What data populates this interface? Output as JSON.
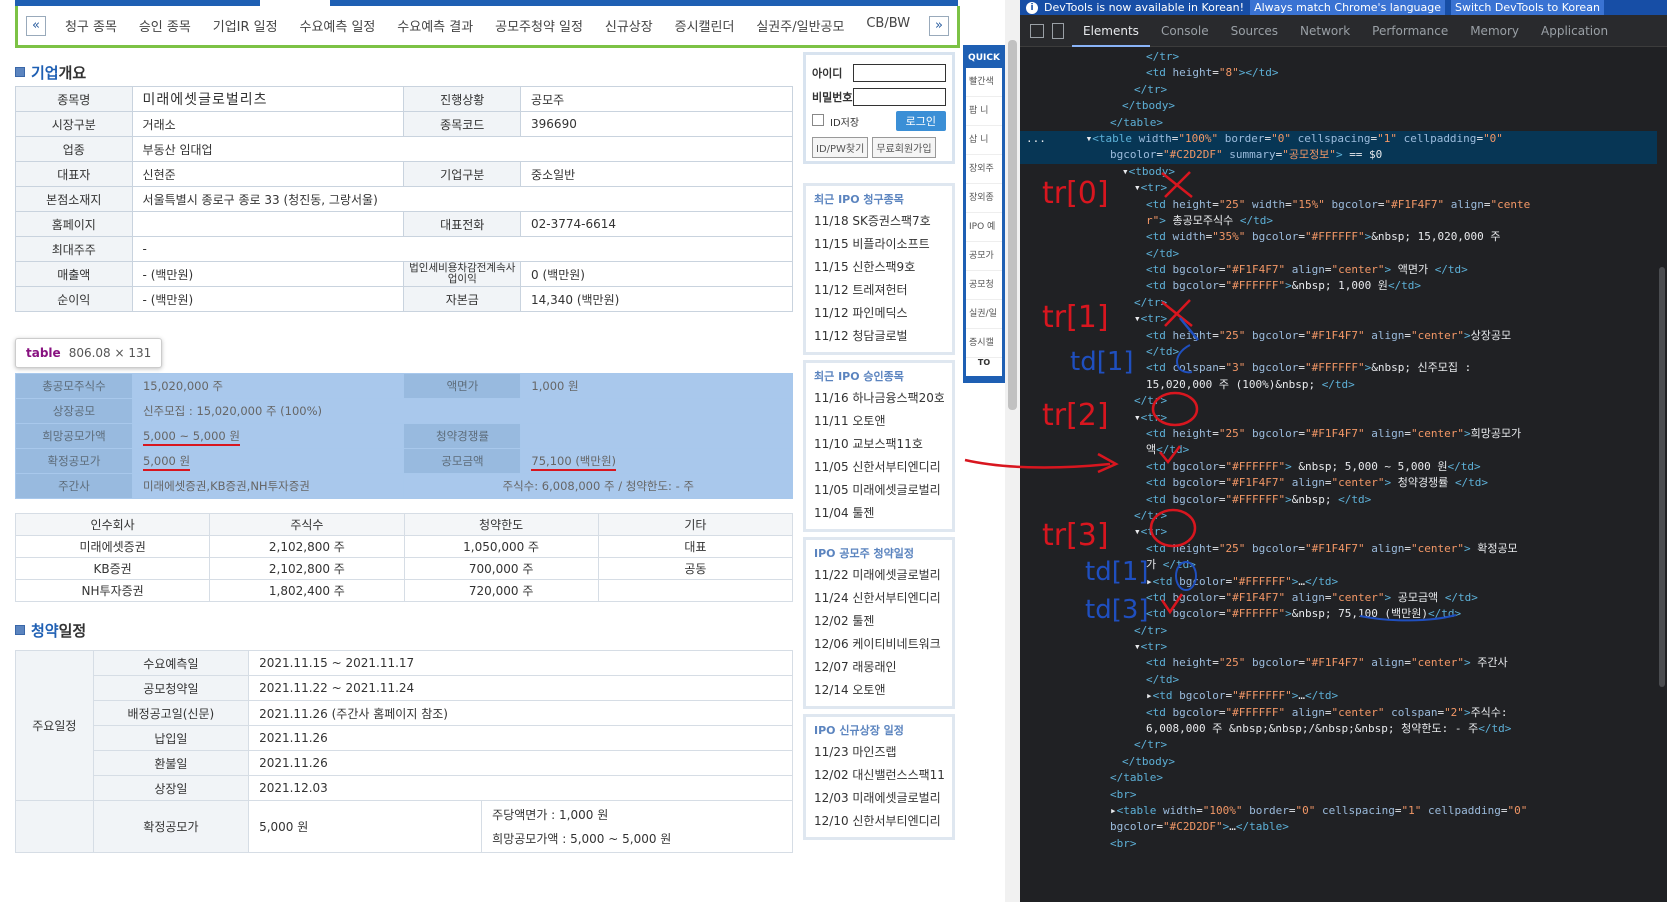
{
  "nav": {
    "items": [
      "청구 종목",
      "승인 종목",
      "기업IR 일정",
      "수요예측 일정",
      "수요예측 결과",
      "공모주청약 일정",
      "신규상장",
      "증시캘린더",
      "실권주/일반공모",
      "CB/BW"
    ],
    "prev": "«",
    "next": "»"
  },
  "company": {
    "section_title_accent": "기업",
    "section_title_rest": " 개요",
    "rows": [
      {
        "k1": "종목명",
        "v1": "미래에셋글로벌리츠",
        "k2": "진행상황",
        "v2": "공모주"
      },
      {
        "k1": "시장구분",
        "v1": "거래소",
        "k2": "종목코드",
        "v2": "396690"
      },
      {
        "k1": "업종",
        "v1": "부동산 임대업"
      },
      {
        "k1": "대표자",
        "v1": "신현준",
        "k2": "기업구분",
        "v2": "중소일반"
      },
      {
        "k1": "본점소재지",
        "v1": "서울특별시 종로구 종로 33 (청진동, 그랑서울)"
      },
      {
        "k1": "홈페이지",
        "v1": "",
        "k2": "대표전화",
        "v2": "02-3774-6614"
      },
      {
        "k1": "최대주주",
        "v1": "-"
      },
      {
        "k1": "매출액",
        "v1": "- (백만원)",
        "k2": "법인세비용차감전계속사업이익",
        "v2": "0 (백만원)"
      },
      {
        "k1": "순이익",
        "v1": "- (백만원)",
        "k2": "자본금",
        "v2": "14,340 (백만원)"
      }
    ]
  },
  "tooltip": {
    "tag": "table",
    "dims": "806.08 × 131"
  },
  "offer": {
    "rows": [
      {
        "k1": "총공모주식수",
        "v1": "15,020,000 주",
        "k2": "액면가",
        "v2": "1,000 원"
      },
      {
        "k1": "상장공모",
        "v1": "신주모집 : 15,020,000 주 (100%)"
      },
      {
        "k1": "희망공모가액",
        "v1": "5,000 ~ 5,000 원",
        "k2": "청약경쟁률",
        "v2": ""
      },
      {
        "k1": "확정공모가",
        "v1": "5,000 원",
        "k2": "공모금액",
        "v2": "75,100 (백만원)"
      },
      {
        "k1": "주간사",
        "v1": "미래에셋증권,KB증권,NH투자증권",
        "v2": "주식수: 6,008,000 주  /  청약한도: - 주"
      }
    ]
  },
  "underwriters": {
    "headers": [
      "인수회사",
      "주식수",
      "청약한도",
      "기타"
    ],
    "rows": [
      [
        "미래에셋증권",
        "2,102,800 주",
        "1,050,000 주",
        "대표"
      ],
      [
        "KB증권",
        "2,102,800 주",
        "700,000 주",
        "공동"
      ],
      [
        "NH투자증권",
        "1,802,400 주",
        "720,000 주",
        ""
      ]
    ]
  },
  "schedule": {
    "section_title_accent": "청약",
    "section_title_rest": " 일정",
    "group_label": "주요일정",
    "rows": [
      {
        "k": "수요예측일",
        "v": "2021.11.15  ~  2021.11.17"
      },
      {
        "k": "공모청약일",
        "v": "2021.11.22  ~  2021.11.24"
      },
      {
        "k": "배정공고일(신문)",
        "v": "2021.11.26 (주간사 홈페이지 참조)"
      },
      {
        "k": "납입일",
        "v": "2021.11.26"
      },
      {
        "k": "환불일",
        "v": "2021.11.26"
      },
      {
        "k": "상장일",
        "v": "2021.12.03"
      }
    ],
    "final_label": "확정공모가",
    "final_value": "5,000 원",
    "par_label": "주당액면가 :  1,000 원",
    "hope_label": "희망공모가액 :  5,000 ~ 5,000 원"
  },
  "login": {
    "id_label": "아이디",
    "pw_label": "비밀번호",
    "save_id": "ID저장",
    "login_btn": "로그인",
    "find_btn": "ID/PW찾기",
    "join_btn": "무료회원가입"
  },
  "side": {
    "recent_claim": {
      "title": "최근 IPO 청구종목",
      "items": [
        "11/18 SK증권스팩7호",
        "11/15 비플라이소프트",
        "11/15 신한스팩9호",
        "11/12 트레져헌터",
        "11/12 파인메딕스",
        "11/12 청담글로벌"
      ]
    },
    "recent_approve": {
      "title": "최근 IPO 승인종목",
      "items": [
        "11/16 하나금융스팩20호",
        "11/11 오토앤",
        "11/10 교보스팩11호",
        "11/05 신한서부티엔디리",
        "11/05 미래에셋글로벌리",
        "11/04 툴젠"
      ]
    },
    "ipo_sub": {
      "title": "IPO 공모주 청약일정",
      "items": [
        "11/22 미래에셋글로벌리",
        "11/24 신한서부티엔디리",
        "12/02 툴젠",
        "12/06 케이티비네트워크",
        "12/07 래몽래인",
        "12/14 오토앤"
      ]
    },
    "ipo_new": {
      "title": "IPO 신규상장 일정",
      "items": [
        "11/23 마인즈랩",
        "12/02 대신밸런스스팩11",
        "12/03 미래에셋글로벌리",
        "12/10 신한서부티엔디리"
      ]
    }
  },
  "quick": {
    "title": "QUICK",
    "items": [
      "빨간색",
      "팝 니",
      "삽 니",
      "장외주",
      "장외종",
      "IPO 예",
      "공모가",
      "공모청",
      "실권/일",
      "증시캘"
    ],
    "top": "TO"
  },
  "devtools": {
    "banner_text": "DevTools is now available in Korean!",
    "banner_btn1": "Always match Chrome's language",
    "banner_btn2": "Switch DevTools to Korean",
    "tabs": [
      "Elements",
      "Console",
      "Sources",
      "Network",
      "Performance",
      "Memory",
      "Application"
    ],
    "active_tab": "Elements",
    "code_lines": [
      {
        "indent": 10,
        "html": "<span class='tg'>&lt;/tr&gt;</span>"
      },
      {
        "indent": 10,
        "html": "<span class='tg'>&lt;td </span><span class='at'>height</span>=<span class='av'>\"8\"</span><span class='tg'>&gt;&lt;/td&gt;</span>"
      },
      {
        "indent": 9,
        "html": "<span class='tg'>&lt;/tr&gt;</span>"
      },
      {
        "indent": 8,
        "html": "<span class='tg'>&lt;/tbody&gt;</span>"
      },
      {
        "indent": 7,
        "html": "<span class='tg'>&lt;/table&gt;</span>"
      },
      {
        "indent": 0,
        "sel": true,
        "html": "<span class='tx'>...      ▾</span><span class='tg'>&lt;table </span><span class='at'>width</span>=<span class='av'>\"100%\"</span> <span class='at'>border</span>=<span class='av'>\"0\"</span> <span class='at'>cellspacing</span>=<span class='av'>\"1\"</span> <span class='at'>cellpadding</span>=<span class='av'>\"0\"</span>"
      },
      {
        "indent": 7,
        "sel": true,
        "html": "<span class='at'>bgcolor</span>=<span class='av'>\"#C2D2DF\"</span> <span class='at'>summary</span>=<span class='av'>\"공모정보\"</span><span class='tg'>&gt;</span> <span class='tx'>== $0</span>"
      },
      {
        "indent": 8,
        "html": "<span class='tx'>▾</span><span class='tg'>&lt;tbody&gt;</span>"
      },
      {
        "indent": 9,
        "html": "<span class='tx'>▾</span><span class='tg'>&lt;tr&gt;</span>"
      },
      {
        "indent": 10,
        "html": "<span class='tg'>&lt;td </span><span class='at'>height</span>=<span class='av'>\"25\"</span> <span class='at'>width</span>=<span class='av'>\"15%\"</span> <span class='at'>bgcolor</span>=<span class='av'>\"#F1F4F7\"</span> <span class='at'>align</span>=<span class='av'>\"cente</span>"
      },
      {
        "indent": 10,
        "html": "<span class='av'>r\"</span><span class='tg'>&gt;</span> 총공모주식수 <span class='tg'>&lt;/td&gt;</span>"
      },
      {
        "indent": 10,
        "html": "<span class='tg'>&lt;td </span><span class='at'>width</span>=<span class='av'>\"35%\"</span> <span class='at'>bgcolor</span>=<span class='av'>\"#FFFFFF\"</span><span class='tg'>&gt;</span>&amp;nbsp; 15,020,000 주"
      },
      {
        "indent": 10,
        "html": "<span class='tg'>&lt;/td&gt;</span>"
      },
      {
        "indent": 10,
        "html": "<span class='tg'>&lt;td </span><span class='at'>bgcolor</span>=<span class='av'>\"#F1F4F7\"</span> <span class='at'>align</span>=<span class='av'>\"center\"</span><span class='tg'>&gt;</span> 액면가 <span class='tg'>&lt;/td&gt;</span>"
      },
      {
        "indent": 10,
        "html": "<span class='tg'>&lt;td </span><span class='at'>bgcolor</span>=<span class='av'>\"#FFFFFF\"</span><span class='tg'>&gt;</span>&amp;nbsp; 1,000 원<span class='tg'>&lt;/td&gt;</span>"
      },
      {
        "indent": 9,
        "html": "<span class='tg'>&lt;/tr&gt;</span>"
      },
      {
        "indent": 9,
        "html": "<span class='tx'>▾</span><span class='tg'>&lt;tr&gt;</span>"
      },
      {
        "indent": 10,
        "html": "<span class='tg'>&lt;td </span><span class='at'>height</span>=<span class='av'>\"25\"</span> <span class='at'>bgcolor</span>=<span class='av'>\"#F1F4F7\"</span> <span class='at'>align</span>=<span class='av'>\"center\"</span><span class='tg'>&gt;</span>상장공모"
      },
      {
        "indent": 10,
        "html": "<span class='tg'>&lt;/td&gt;</span>"
      },
      {
        "indent": 10,
        "html": "<span class='tg'>&lt;td </span><span class='at'>colspan</span>=<span class='av'>\"3\"</span> <span class='at'>bgcolor</span>=<span class='av'>\"#FFFFFF\"</span><span class='tg'>&gt;</span>&amp;nbsp; 신주모집 :"
      },
      {
        "indent": 10,
        "html": "15,020,000 주 (100%)&amp;nbsp; <span class='tg'>&lt;/td&gt;</span>"
      },
      {
        "indent": 9,
        "html": "<span class='tg'>&lt;/tr&gt;</span>"
      },
      {
        "indent": 9,
        "html": "<span class='tx'>▾</span><span class='tg'>&lt;tr&gt;</span>"
      },
      {
        "indent": 10,
        "html": "<span class='tg'>&lt;td </span><span class='at'>height</span>=<span class='av'>\"25\"</span> <span class='at'>bgcolor</span>=<span class='av'>\"#F1F4F7\"</span> <span class='at'>align</span>=<span class='av'>\"center\"</span><span class='tg'>&gt;</span>희망공모가"
      },
      {
        "indent": 10,
        "html": "액<span class='tg'>&lt;/td&gt;</span>"
      },
      {
        "indent": 10,
        "html": "<span class='tg'>&lt;td </span><span class='at'>bgcolor</span>=<span class='av'>\"#FFFFFF\"</span><span class='tg'>&gt;</span> &amp;nbsp; 5,000 ~ 5,000 원<span class='tg'>&lt;/td&gt;</span>"
      },
      {
        "indent": 10,
        "html": "<span class='tg'>&lt;td </span><span class='at'>bgcolor</span>=<span class='av'>\"#F1F4F7\"</span> <span class='at'>align</span>=<span class='av'>\"center\"</span><span class='tg'>&gt;</span> 청약경쟁률 <span class='tg'>&lt;/td&gt;</span>"
      },
      {
        "indent": 10,
        "html": "<span class='tg'>&lt;td </span><span class='at'>bgcolor</span>=<span class='av'>\"#FFFFFF\"</span><span class='tg'>&gt;</span>&amp;nbsp; <span class='tg'>&lt;/td&gt;</span>"
      },
      {
        "indent": 9,
        "html": "<span class='tg'>&lt;/tr&gt;</span>"
      },
      {
        "indent": 9,
        "html": "<span class='tx'>▾</span><span class='tg'>&lt;tr&gt;</span>"
      },
      {
        "indent": 10,
        "html": "<span class='tg'>&lt;td </span><span class='at'>height</span>=<span class='av'>\"25\"</span> <span class='at'>bgcolor</span>=<span class='av'>\"#F1F4F7\"</span> <span class='at'>align</span>=<span class='av'>\"center\"</span><span class='tg'>&gt;</span> 확정공모"
      },
      {
        "indent": 10,
        "html": "가 <span class='tg'>&lt;/td&gt;</span>"
      },
      {
        "indent": 10,
        "html": "<span class='tx'>▸</span><span class='tg'>&lt;td </span><span class='at'>bgcolor</span>=<span class='av'>\"#FFFFFF\"</span><span class='tg'>&gt;</span>…<span class='tg'>&lt;/td&gt;</span>"
      },
      {
        "indent": 10,
        "html": "<span class='tg'>&lt;td </span><span class='at'>bgcolor</span>=<span class='av'>\"#F1F4F7\"</span> <span class='at'>align</span>=<span class='av'>\"center\"</span><span class='tg'>&gt;</span> 공모금액 <span class='tg'>&lt;/td&gt;</span>"
      },
      {
        "indent": 10,
        "html": "<span class='tg'>&lt;td </span><span class='at'>bgcolor</span>=<span class='av'>\"#FFFFFF\"</span><span class='tg'>&gt;</span>&amp;nbsp; 75,100 (백만원)<span class='tg'>&lt;/td&gt;</span>"
      },
      {
        "indent": 9,
        "html": "<span class='tg'>&lt;/tr&gt;</span>"
      },
      {
        "indent": 9,
        "html": "<span class='tx'>▾</span><span class='tg'>&lt;tr&gt;</span>"
      },
      {
        "indent": 10,
        "html": "<span class='tg'>&lt;td </span><span class='at'>height</span>=<span class='av'>\"25\"</span> <span class='at'>bgcolor</span>=<span class='av'>\"#F1F4F7\"</span> <span class='at'>align</span>=<span class='av'>\"center\"</span><span class='tg'>&gt;</span> 주간사"
      },
      {
        "indent": 10,
        "html": "<span class='tg'>&lt;/td&gt;</span>"
      },
      {
        "indent": 10,
        "html": "<span class='tx'>▸</span><span class='tg'>&lt;td </span><span class='at'>bgcolor</span>=<span class='av'>\"#FFFFFF\"</span><span class='tg'>&gt;</span>…<span class='tg'>&lt;/td&gt;</span>"
      },
      {
        "indent": 10,
        "html": "<span class='tg'>&lt;td </span><span class='at'>bgcolor</span>=<span class='av'>\"#FFFFFF\"</span> <span class='at'>align</span>=<span class='av'>\"center\"</span> <span class='at'>colspan</span>=<span class='av'>\"2\"</span><span class='tg'>&gt;</span>주식수:"
      },
      {
        "indent": 10,
        "html": "6,008,000 주 &amp;nbsp;&amp;nbsp;/&amp;nbsp;&amp;nbsp; 청약한도: - 주<span class='tg'>&lt;/td&gt;</span>"
      },
      {
        "indent": 9,
        "html": "<span class='tg'>&lt;/tr&gt;</span>"
      },
      {
        "indent": 8,
        "html": "<span class='tg'>&lt;/tbody&gt;</span>"
      },
      {
        "indent": 7,
        "html": "<span class='tg'>&lt;/table&gt;</span>"
      },
      {
        "indent": 7,
        "html": "<span class='tg'>&lt;br&gt;</span>"
      },
      {
        "indent": 7,
        "html": "<span class='tx'>▸</span><span class='tg'>&lt;table </span><span class='at'>width</span>=<span class='av'>\"100%\"</span> <span class='at'>border</span>=<span class='av'>\"0\"</span> <span class='at'>cellspacing</span>=<span class='av'>\"1\"</span> <span class='at'>cellpadding</span>=<span class='av'>\"0\"</span>"
      },
      {
        "indent": 7,
        "html": "<span class='at'>bgcolor</span>=<span class='av'>\"#C2D2DF\"</span><span class='tg'>&gt;</span>…<span class='tg'>&lt;/table&gt;</span>"
      },
      {
        "indent": 7,
        "html": "<span class='tg'>&lt;br&gt;</span>"
      }
    ],
    "annotations": [
      "tr[0]",
      "tr[1]",
      "td[1]",
      "tr[2]",
      "tr[3]",
      "td[1]",
      "td[3]"
    ]
  },
  "colors": {
    "accent": "#1e5fb3",
    "highlight": "#a9c8ec",
    "annotation_red": "#d8161f",
    "annotation_blue": "#1f4fbf",
    "nav_border": "#7cc245"
  }
}
